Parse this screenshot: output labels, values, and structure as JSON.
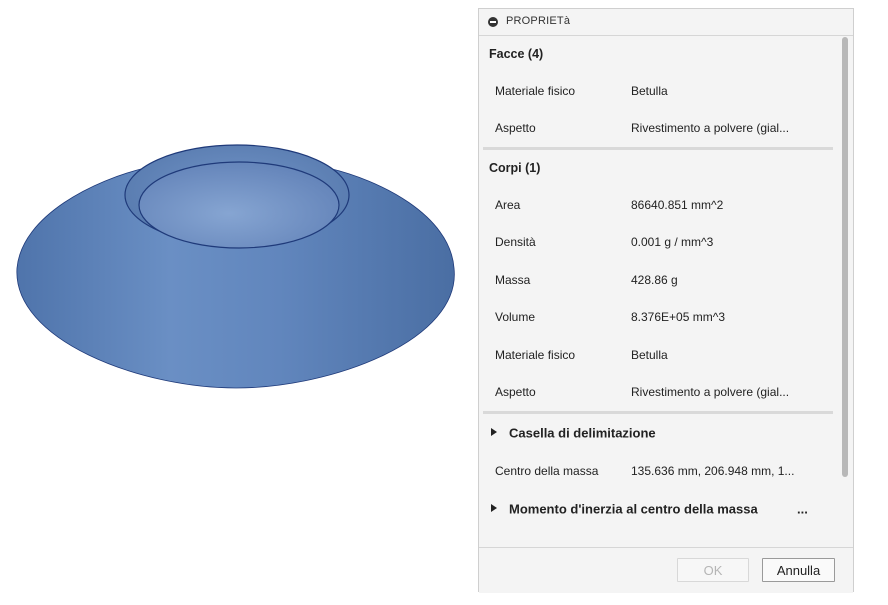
{
  "panel": {
    "title": "PROPRIETà",
    "faces_section": {
      "title": "Facce (4)",
      "rows": [
        {
          "label": "Materiale fisico",
          "value": "Betulla"
        },
        {
          "label": "Aspetto",
          "value": "Rivestimento a polvere (gial..."
        }
      ]
    },
    "bodies_section": {
      "title": "Corpi (1)",
      "rows": [
        {
          "label": "Area",
          "value": "86640.851 mm^2"
        },
        {
          "label": "Densità",
          "value": "0.001 g / mm^3"
        },
        {
          "label": "Massa",
          "value": "428.86 g"
        },
        {
          "label": "Volume",
          "value": "8.376E+05 mm^3"
        },
        {
          "label": "Materiale fisico",
          "value": "Betulla"
        },
        {
          "label": "Aspetto",
          "value": "Rivestimento a polvere (gial..."
        }
      ]
    },
    "bounding_box": {
      "label": "Casella di delimitazione"
    },
    "center_of_mass": {
      "label": "Centro della massa",
      "value": "135.636 mm, 206.948 mm, 1..."
    },
    "inertia": {
      "label": "Momento d'inerzia al centro della massa",
      "more": "..."
    },
    "buttons": {
      "ok": "OK",
      "cancel": "Annulla"
    }
  },
  "colors": {
    "body_fill": "#5b80b4",
    "body_edge": "#1f3a7a",
    "panel_bg": "#f4f4f4"
  }
}
